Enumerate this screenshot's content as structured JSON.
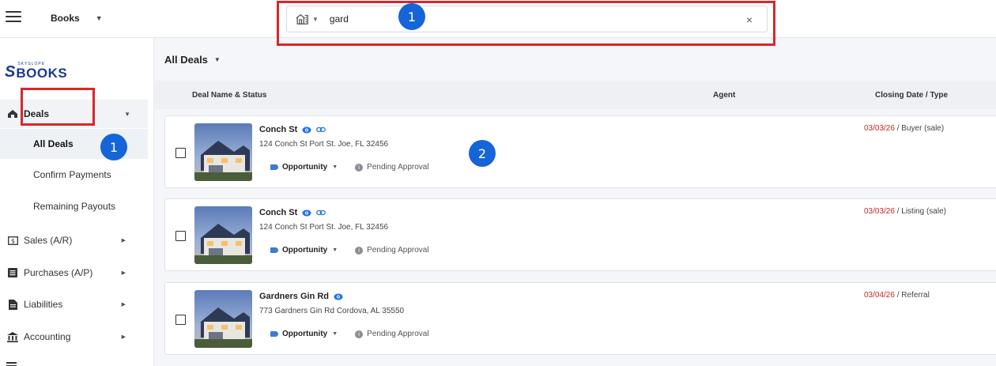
{
  "header": {
    "org_name": "Books",
    "search": {
      "value": "gard",
      "clear_symbol": "×"
    }
  },
  "markers": {
    "search": "1",
    "nav": "1",
    "deal": "2"
  },
  "logo": {
    "small_text": "SKYSLOPE",
    "big_text": "BOOKS"
  },
  "sidebar": {
    "deals_label": "Deals",
    "sub_items": [
      "All Deals",
      "Confirm Payments",
      "Remaining Payouts"
    ],
    "items": [
      "Sales (A/R)",
      "Purchases (A/P)",
      "Liabilities",
      "Accounting"
    ]
  },
  "main": {
    "title": "All Deals",
    "columns": {
      "name": "Deal Name & Status",
      "agent": "Agent",
      "closing": "Closing Date / Type"
    },
    "deals": [
      {
        "name": "Conch St",
        "address": "124 Conch St Port St. Joe, FL 32456",
        "status": "Opportunity",
        "approval": "Pending Approval",
        "date": "03/03/26",
        "type": " / Buyer (sale)"
      },
      {
        "name": "Conch St",
        "address": "124 Conch St Port St. Joe, FL 32456",
        "status": "Opportunity",
        "approval": "Pending Approval",
        "date": "03/03/26",
        "type": " / Listing (sale)"
      },
      {
        "name": "Gardners Gin Rd",
        "address": "773 Gardners Gin Rd Cordova, AL 35550",
        "status": "Opportunity",
        "approval": "Pending Approval",
        "date": "03/04/26",
        "type": " / Referral"
      }
    ]
  },
  "colors": {
    "accent": "#1565d8",
    "highlight": "#d9262c",
    "date_red": "#c62828",
    "logo_blue": "#1b3a8c"
  }
}
